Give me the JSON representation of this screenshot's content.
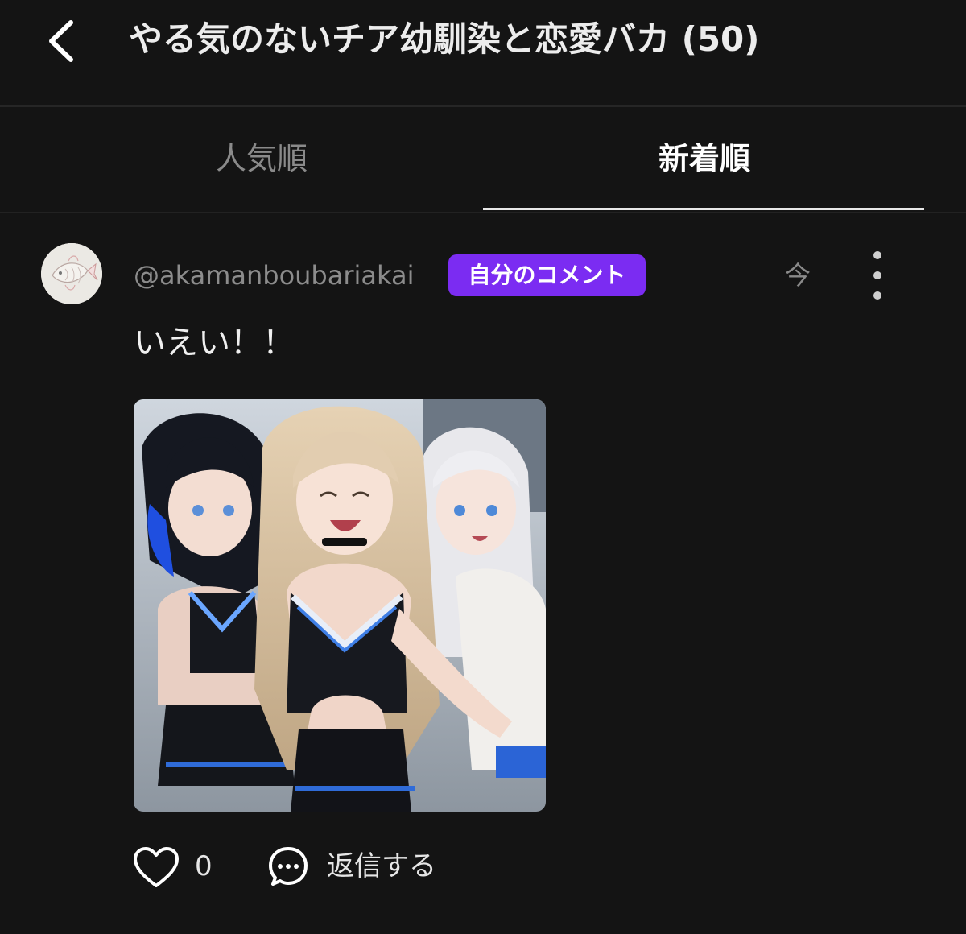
{
  "header": {
    "title": "やる気のないチア幼馴染と恋愛バカ (50)"
  },
  "tabs": [
    {
      "label": "人気順",
      "active": false
    },
    {
      "label": "新着順",
      "active": true
    }
  ],
  "comment": {
    "username": "@akamanboubariakai",
    "badge": "自分のコメント",
    "timestamp": "今",
    "text": "いえい！！",
    "likes": "0",
    "reply_label": "返信する"
  },
  "colors": {
    "background": "#141414",
    "badge": "#7b2cf2",
    "tab_indicator": "#e8e8e8",
    "muted_text": "#8c8c8c"
  },
  "icons": {
    "back": "chevron-left-icon",
    "more": "vertical-dots-icon",
    "like": "heart-outline-icon",
    "reply": "speech-bubble-icon"
  }
}
